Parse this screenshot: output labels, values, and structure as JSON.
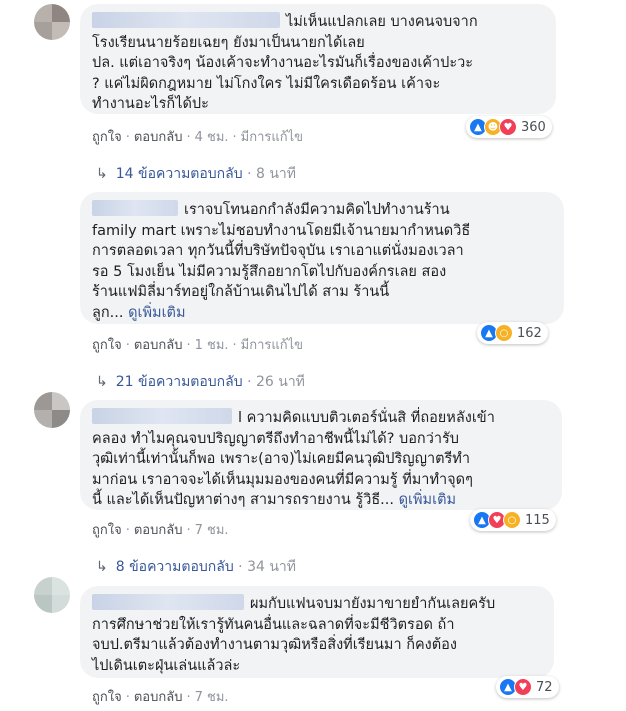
{
  "comments": [
    {
      "text": "ไม่เห็นแปลกเลย บางคนจบจาก\nโรงเรียนนายร้อยเฉยๆ ยังมาเป็นนายกได้เลย\nปล. แต่เอาจริงๆ น้องเค้าจะทำงานอะไรมันก็เรื่องของเค้าปะวะ\n? แค่ไม่ผิดกฎหมาย ไม่โกงใคร ไม่มีใครเดือดร้อน เค้าจะ\nทำงานอะไรก็ได้ปะ",
      "see_more": "",
      "like": "ถูกใจ",
      "reply": "ตอบกลับ",
      "time": "4 ชม.",
      "edited": "มีการแก้ไข",
      "reaction_icons": [
        "like-icon",
        "haha-icon",
        "love-icon"
      ],
      "reaction_count": "360",
      "replies_count": "14 ข้อความตอบกลับ",
      "replies_time": "8 นาที"
    },
    {
      "text": "เราจบโทนอกกำลังมีความคิดไปทำงานร้าน\nfamily mart เพราะไม่ชอบทำงานโดยมีเจ้านายมากำหนดวิธี\nการตลอดเวลา ทุกวันนี้ที่บริษัทปัจจุบัน เราเอาแต่นั่งมองเวลา\nรอ 5 โมงเย็น ไม่มีความรู้สึกอยากโตไปกับองค์กรเลย สอง\nร้านแฟมิลี่มาร์ทอยู่ใกล้บ้านเดินไปได้ สาม ร้านนี้\nลูก... ",
      "see_more": "ดูเพิ่มเติม",
      "like": "ถูกใจ",
      "reply": "ตอบกลับ",
      "time": "1 ชม.",
      "edited": "มีการแก้ไข",
      "reaction_icons": [
        "like-icon",
        "wow-icon"
      ],
      "reaction_count": "162",
      "replies_count": "21 ข้อความตอบกลับ",
      "replies_time": "26 นาที"
    },
    {
      "text": "l ความคิดแบบติวเตอร์นั่นสิ ที่ถอยหลังเข้า\nคลอง ทำไมคุณจบปริญญาตรีถึงทำอาชีพนี้ไม่ได้? บอกว่ารับ\nวุฒิเท่านี้เท่านั้นก็พอ เพราะ(อาจ)ไม่เคยมีคนวุฒิปริญญาตรีทำ\nมาก่อน เราอาจจะได้เห็นมุมมองของคนที่มีความรู้ ที่มาทำจุดๆ\nนี้ และได้เห็นปัญหาต่างๆ สามารถรายงาน รู้วิธี... ",
      "see_more": "ดูเพิ่มเติม",
      "like": "ถูกใจ",
      "reply": "ตอบกลับ",
      "time": "7 ชม.",
      "edited": "",
      "reaction_icons": [
        "like-icon",
        "love-icon",
        "wow-icon"
      ],
      "reaction_count": "115",
      "replies_count": "8 ข้อความตอบกลับ",
      "replies_time": "34 นาที"
    },
    {
      "text": "ผมกับแฟนจบมายังมาขายยำกันเลยครับ\nการศึกษาช่วยให้เรารู้ทันคนอื่นและฉลาดที่จะมีชีวิตรอด ถ้า\nจบป.ตรีมาแล้วต้องทำงานตามวุฒิหรือสิ่งที่เรียนมา ก็คงต้อง\nไปเดินเตะฝุ่นเล่นแล้วล่ะ",
      "see_more": "",
      "like": "ถูกใจ",
      "reply": "ตอบกลับ",
      "time": "7 ชม.",
      "edited": "",
      "reaction_icons": [
        "like-icon",
        "love-icon"
      ],
      "reaction_count": "72",
      "replies_count": "",
      "replies_time": ""
    }
  ],
  "colors": {
    "bubble": "#f2f3f5",
    "link": "#385898",
    "meta": "#90949c",
    "like": "#1877f2",
    "love": "#f33e58",
    "haha_wow": "#f7b125"
  }
}
